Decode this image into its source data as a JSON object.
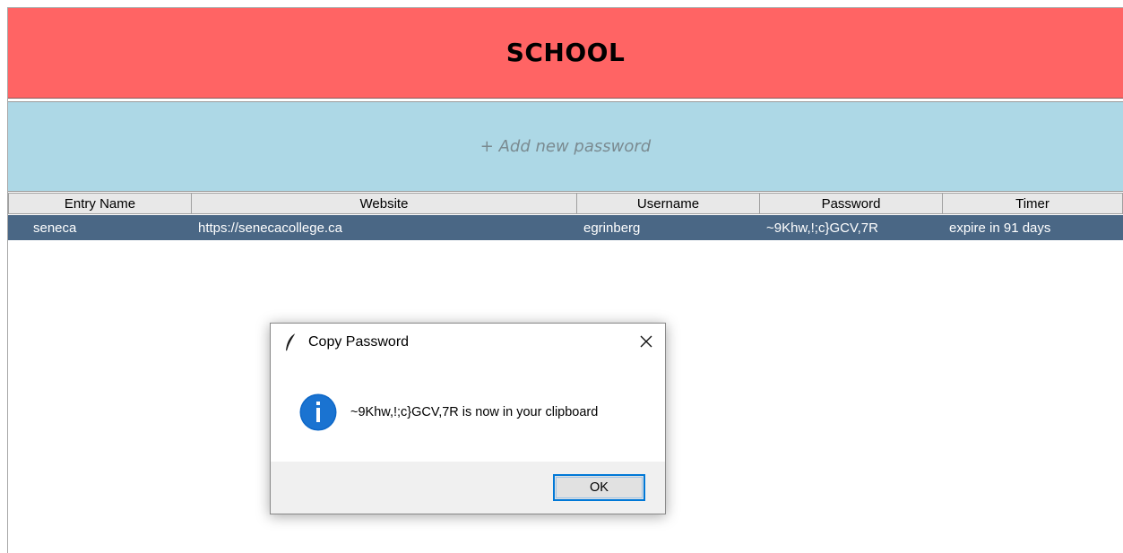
{
  "category": {
    "title": "SCHOOL",
    "color": "#ff6464"
  },
  "add_bar": {
    "label": "+ Add new password",
    "color": "#add8e6"
  },
  "table": {
    "columns": [
      "Entry Name",
      "Website",
      "Username",
      "Password",
      "Timer"
    ],
    "rows": [
      {
        "entry_name": "seneca",
        "website": "https://senecacollege.ca",
        "username": "egrinberg",
        "password": "~9Khw,!;c}GCV,7R",
        "timer": "expire in 91 days"
      }
    ],
    "selected_row_color": "#4a6785"
  },
  "dialog": {
    "title": "Copy Password",
    "title_icon": "feather-icon",
    "message": "~9Khw,!;c}GCV,7R is now in your clipboard",
    "message_icon": "info-icon",
    "ok_label": "OK",
    "accent": "#0078d7"
  }
}
